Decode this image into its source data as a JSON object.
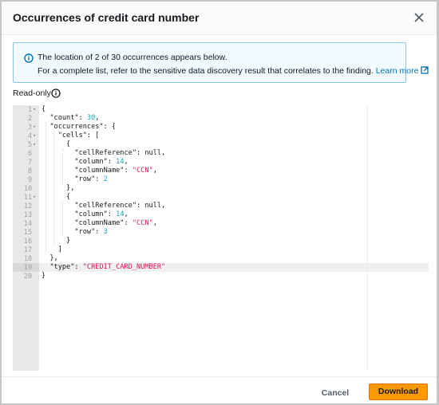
{
  "dialog": {
    "title": "Occurrences of credit card number",
    "close_icon": "close-icon"
  },
  "alert": {
    "icon": "info-icon",
    "line1": "The location of 2 of 30 occurrences appears below.",
    "line2": "For a complete list, refer to the sensitive data discovery result that correlates to the finding.",
    "link_label": "Learn more",
    "link_icon": "external-link-icon",
    "accent": "#0073bb",
    "background": "#f1faff",
    "border": "#8ac5e8"
  },
  "editor": {
    "label": "Read-only",
    "label_icon": "info-icon",
    "lines": [
      {
        "n": "1",
        "fold": true,
        "tokens": [
          {
            "t": "p",
            "v": "{"
          }
        ]
      },
      {
        "n": "2",
        "fold": false,
        "tokens": [
          {
            "t": "p",
            "v": "  \"count\": "
          },
          {
            "t": "n",
            "v": "30"
          },
          {
            "t": "p",
            "v": ","
          }
        ]
      },
      {
        "n": "3",
        "fold": true,
        "tokens": [
          {
            "t": "p",
            "v": "  \"occurrences\": {"
          }
        ]
      },
      {
        "n": "4",
        "fold": true,
        "tokens": [
          {
            "t": "p",
            "v": "    \"cells\": ["
          }
        ]
      },
      {
        "n": "5",
        "fold": true,
        "tokens": [
          {
            "t": "p",
            "v": "      {"
          }
        ]
      },
      {
        "n": "6",
        "fold": false,
        "tokens": [
          {
            "t": "p",
            "v": "        \"cellReference\": null,"
          }
        ]
      },
      {
        "n": "7",
        "fold": false,
        "tokens": [
          {
            "t": "p",
            "v": "        \"column\": "
          },
          {
            "t": "n",
            "v": "14"
          },
          {
            "t": "p",
            "v": ","
          }
        ]
      },
      {
        "n": "8",
        "fold": false,
        "tokens": [
          {
            "t": "p",
            "v": "        \"columnName\": "
          },
          {
            "t": "s",
            "v": "\"CCN\""
          },
          {
            "t": "p",
            "v": ","
          }
        ]
      },
      {
        "n": "9",
        "fold": false,
        "tokens": [
          {
            "t": "p",
            "v": "        \"row\": "
          },
          {
            "t": "n",
            "v": "2"
          }
        ]
      },
      {
        "n": "10",
        "fold": false,
        "tokens": [
          {
            "t": "p",
            "v": "      },"
          }
        ]
      },
      {
        "n": "11",
        "fold": true,
        "tokens": [
          {
            "t": "p",
            "v": "      {"
          }
        ]
      },
      {
        "n": "12",
        "fold": false,
        "tokens": [
          {
            "t": "p",
            "v": "        \"cellReference\": null,"
          }
        ]
      },
      {
        "n": "13",
        "fold": false,
        "tokens": [
          {
            "t": "p",
            "v": "        \"column\": "
          },
          {
            "t": "n",
            "v": "14"
          },
          {
            "t": "p",
            "v": ","
          }
        ]
      },
      {
        "n": "14",
        "fold": false,
        "tokens": [
          {
            "t": "p",
            "v": "        \"columnName\": "
          },
          {
            "t": "s",
            "v": "\"CCN\""
          },
          {
            "t": "p",
            "v": ","
          }
        ]
      },
      {
        "n": "15",
        "fold": false,
        "tokens": [
          {
            "t": "p",
            "v": "        \"row\": "
          },
          {
            "t": "n",
            "v": "3"
          }
        ]
      },
      {
        "n": "16",
        "fold": false,
        "tokens": [
          {
            "t": "p",
            "v": "      }"
          }
        ]
      },
      {
        "n": "17",
        "fold": false,
        "tokens": [
          {
            "t": "p",
            "v": "    ]"
          }
        ]
      },
      {
        "n": "18",
        "fold": false,
        "tokens": [
          {
            "t": "p",
            "v": "  },"
          }
        ]
      },
      {
        "n": "19",
        "fold": false,
        "tokens": [
          {
            "t": "p",
            "v": "  \"type\": "
          },
          {
            "t": "s",
            "v": "\"CREDIT_CARD_NUMBER\""
          }
        ]
      },
      {
        "n": "20",
        "fold": false,
        "tokens": [
          {
            "t": "p",
            "v": "}"
          }
        ]
      }
    ],
    "active_line": 20,
    "colors": {
      "number": "#1ba3b8",
      "string": "#e0115f"
    }
  },
  "footer": {
    "cancel_label": "Cancel",
    "download_label": "Download",
    "primary_color": "#ff9900"
  }
}
